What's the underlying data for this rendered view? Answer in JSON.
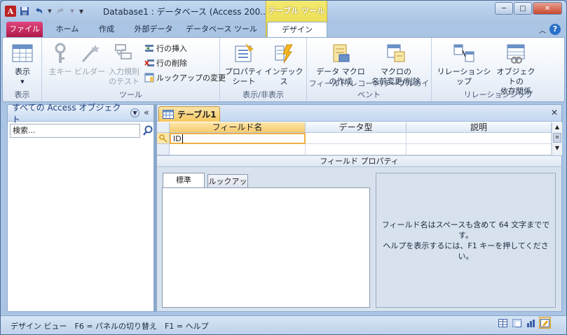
{
  "window": {
    "title": "Database1 : データベース (Access 200...",
    "context_tool": "テーブル ツール",
    "minimize": "─",
    "maximize": "□",
    "close": "✕"
  },
  "tabs": {
    "file": "ファイル",
    "home": "ホーム",
    "create": "作成",
    "external": "外部データ",
    "dbtools": "データベース ツール",
    "design": "デザイン"
  },
  "ribbon": {
    "views": {
      "view_label": "表示",
      "group": "表示"
    },
    "tools": {
      "primary_key": "主キー",
      "builder": "ビルダー",
      "test_rules_1": "入力規則",
      "test_rules_2": "のテスト",
      "insert_rows": "行の挿入",
      "delete_rows": "行の削除",
      "modify_lookups": "ルックアップの変更",
      "group": "ツール"
    },
    "showhide": {
      "property_1": "プロパティ",
      "property_2": "シート",
      "indexes": "インデックス",
      "group": "表示/非表示"
    },
    "events": {
      "data_macro_1": "データ マクロ",
      "data_macro_2": "の作成",
      "rename_macro_1": "マクロの",
      "rename_macro_2": "名前変更/削除",
      "group": "フィールド/レコード/テーブルのイベント"
    },
    "relationships": {
      "relationships": "リレーションシップ",
      "dependencies_1": "オブジェクトの",
      "dependencies_2": "依存関係",
      "group": "リレーションシップ"
    }
  },
  "nav": {
    "title": "すべての Access オブジェクト",
    "collapse": "«",
    "search_placeholder": "検索..."
  },
  "document": {
    "tab_label": "テーブル1",
    "close": "✕",
    "columns": [
      "フィールド名",
      "データ型",
      "説明"
    ],
    "row1_field": "ID",
    "field_properties": "フィールド プロパティ",
    "tab_general": "標準",
    "tab_lookup": "ルックアップ",
    "help_line1": "フィールド名はスペースも含めて 64 文字までです。",
    "help_line2": "ヘルプを表示するには、F1 キーを押してください。"
  },
  "status": {
    "text": "デザイン ビュー　F6 = パネルの切り替え　F1 = ヘルプ"
  },
  "colors": {
    "accent": "#b01848",
    "context": "#e8d648"
  }
}
